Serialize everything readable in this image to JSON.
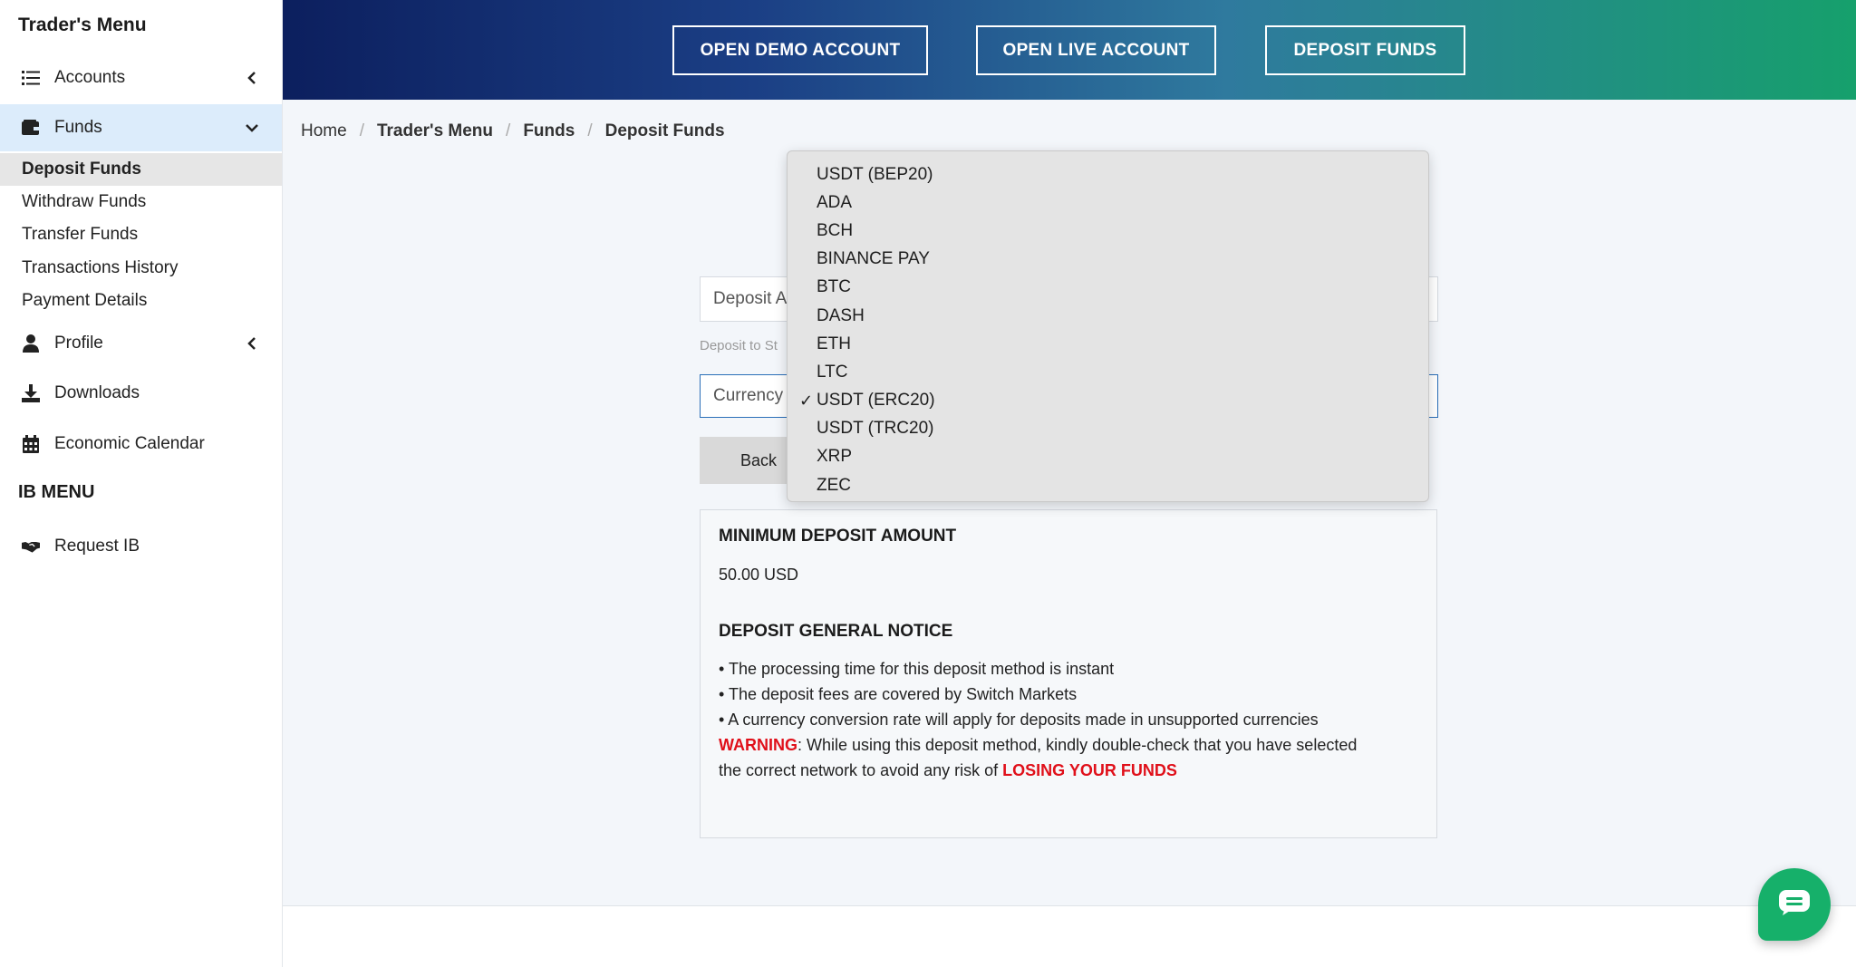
{
  "sidebar": {
    "title": "Trader's Menu",
    "accounts": "Accounts",
    "funds": "Funds",
    "funds_sub": [
      "Deposit Funds",
      "Withdraw Funds",
      "Transfer Funds",
      "Transactions History",
      "Payment Details"
    ],
    "profile": "Profile",
    "downloads": "Downloads",
    "calendar": "Economic Calendar",
    "ib_section": "IB MENU",
    "request_ib": "Request IB"
  },
  "header": {
    "demo": "OPEN DEMO ACCOUNT",
    "live": "OPEN LIVE ACCOUNT",
    "deposit": "DEPOSIT FUNDS"
  },
  "breadcrumb": [
    "Home",
    "Trader's Menu",
    "Funds",
    "Deposit Funds"
  ],
  "form": {
    "deposit_account": "Deposit A",
    "deposit_hint": "Deposit to St",
    "currency": "Currency",
    "back": "Back"
  },
  "dropdown": {
    "options": [
      "USDT (BEP20)",
      "ADA",
      "BCH",
      "BINANCE PAY",
      "BTC",
      "DASH",
      "ETH",
      "LTC",
      "USDT (ERC20)",
      "USDT (TRC20)",
      "XRP",
      "ZEC"
    ],
    "selected": "USDT (ERC20)",
    "check": "✓"
  },
  "info": {
    "min_title": "MINIMUM DEPOSIT AMOUNT",
    "min_value": "50.00 USD",
    "notice_title": "DEPOSIT GENERAL NOTICE",
    "bullets": [
      "• The processing time for this deposit method is instant",
      "• The deposit fees are covered by Switch Markets",
      "• A currency conversion rate will apply for deposits made in unsupported currencies"
    ],
    "warning_label": "WARNING",
    "warning_text": ": While using this deposit method, kindly double-check that you have selected",
    "warning_text2": "the correct network to avoid any risk of ",
    "warning_emph": "LOSING YOUR FUNDS"
  },
  "colors": {
    "accent": "#16b06a",
    "danger": "#e0101a",
    "active_bg": "#dcecfb"
  }
}
